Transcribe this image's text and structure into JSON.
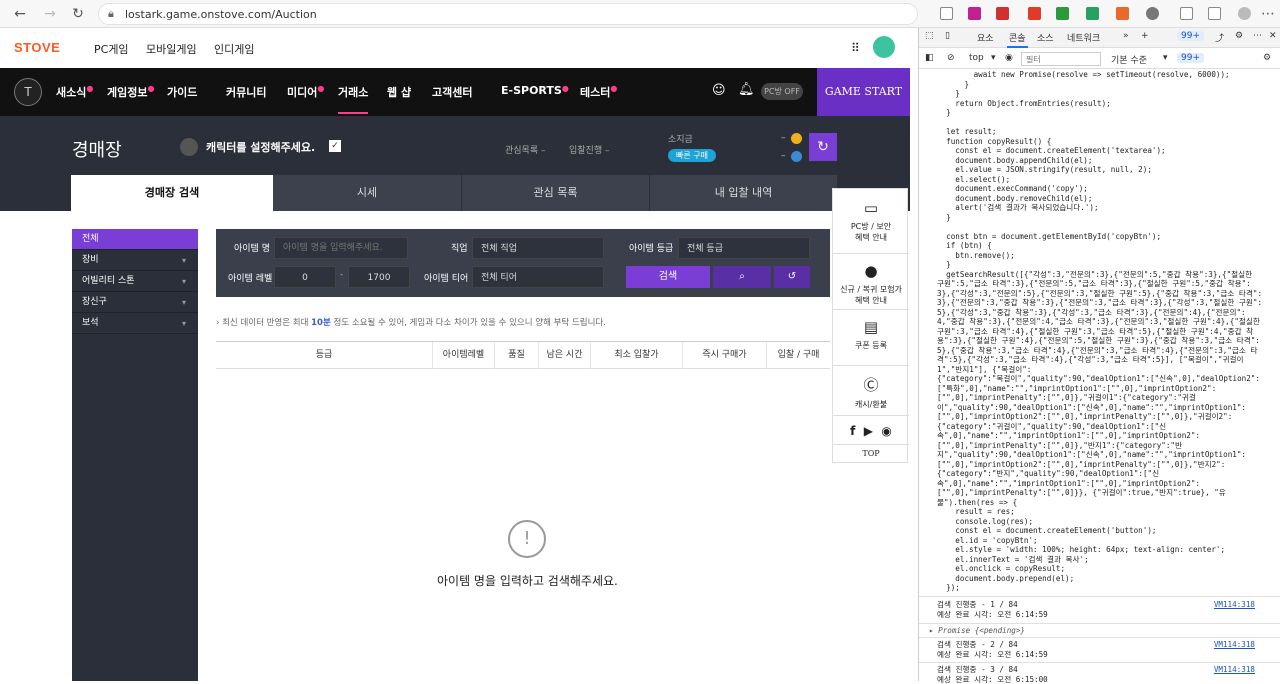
{
  "browser": {
    "url": "lostark.game.onstove.com/Auction",
    "back": "←",
    "refresh": "↻",
    "home": "⌂"
  },
  "site": {
    "logo": "STOVE",
    "topnav": [
      "PC게임",
      "모바일게임",
      "인디게임"
    ],
    "gnb": [
      {
        "label": "새소식",
        "dot": true
      },
      {
        "label": "게임정보",
        "dot": true
      },
      {
        "label": "가이드",
        "dot": false
      },
      {
        "label": "커뮤니티",
        "dot": false
      },
      {
        "label": "미디어",
        "dot": true
      },
      {
        "label": "거래소",
        "dot": false
      },
      {
        "label": "웹 샵",
        "dot": false
      },
      {
        "label": "고객센터",
        "dot": false
      },
      {
        "label": "E-SPORTS",
        "dot": true
      },
      {
        "label": "테스터",
        "dot": true
      }
    ],
    "pc_badge": "PC방 OFF",
    "game_start": "GAME START",
    "page_title": "경매장",
    "character": "캐릭터를 설정해주세요.",
    "watch": "관심목록 –",
    "bidding": "입찰진행 –",
    "owned": "소지금",
    "quick_buy": "빠른 구매",
    "gold1": "–",
    "gold2": "–",
    "tabs": [
      "경매장 검색",
      "시세",
      "관심 목록",
      "내 입찰 내역"
    ],
    "categories": [
      "전체",
      "장비",
      "어빌리티 스톤",
      "장신구",
      "보석"
    ],
    "form": {
      "item_name_label": "아이템 명",
      "item_name_placeholder": "아이템 명을 입력해주세요.",
      "class_label": "직업",
      "class_value": "전체 직업",
      "grade_label": "아이템 등급",
      "grade_value": "전체 등급",
      "level_label": "아이템 레벨",
      "level_min": "0",
      "level_max": "1700",
      "tier_label": "아이템 티어",
      "tier_value": "전체 티어",
      "search": "검색"
    },
    "notice_pre": "최신 데이터 반영은 최대 ",
    "notice_em": "10분",
    "notice_post": " 정도 소요될 수 있어, 게임과 다소 차이가 있을 수 있으니 양해 부탁 드립니다.",
    "columns": [
      "등급",
      "아이템레벨",
      "품질",
      "남은 시간",
      "최소 입찰가",
      "즉시 구매가",
      "입찰 / 구매"
    ],
    "empty": "아이템 명을 입력하고 검색해주세요.",
    "empty_icon": "!",
    "quick": [
      "PC방 / 보안\n혜택 안내",
      "신규 / 복귀 모험가\n혜택 안내",
      "쿠폰 등록",
      "캐시/환불",
      "TOP"
    ]
  },
  "devtools": {
    "tabs": [
      "요소",
      "콘솔",
      "소스",
      "네트워크"
    ],
    "badge": "99+",
    "top": "top",
    "filter_placeholder": "필터",
    "level": "기본 수준",
    "code": "        await new Promise(resolve => setTimeout(resolve, 6000));\n      }\n    }\n    return Object.fromEntries(result);\n  }\n\n  let result;\n  function copyResult() {\n    const el = document.createElement('textarea');\n    document.body.appendChild(el);\n    el.value = JSON.stringify(result, null, 2);\n    el.select();\n    document.execCommand('copy');\n    document.body.removeChild(el);\n    alert('검색 결과가 복사되었습니다.');\n  }\n\n  const btn = document.getElementById('copyBtn');\n  if (btn) {\n    btn.remove();\n  }\n  getSearchResult([{\"각성\":3,\"전문의\":3},{\"전문의\":5,\"중갑 착용\":3},{\"절실한 구원\":5,\"급소 타격\":3},{\"전문의\":5,\"급소 타격\":3},{\"절실한 구원\":5,\"중갑 착용\":3},{\"각성\":3,\"전문의\":5},{\"전문의\":3,\"절실한 구원\":5},{\"중갑 착용\":3,\"급소 타격\":3},{\"전문의\":3,\"중갑 착용\":3},{\"전문의\":3,\"급소 타격\":3},{\"각성\":3,\"절실한 구원\":5},{\"각성\":3,\"중갑 착용\":3},{\"각성\":3,\"급소 타격\":3},{\"전문의\":4},{\"전문의\":4,\"중갑 착용\":3},{\"전문의\":4,\"급소 타격\":3},{\"전문의\":3,\"절실한 구원\":4},{\"절실한 구원\":3,\"급소 타격\":4},{\"절실한 구원\":3,\"급소 타격\":5},{\"절실한 구원\":4,\"중갑 착용\":3},{\"절실한 구원\":4},{\"전문의\":5,\"절실한 구원\":3},{\"중갑 착용\":3,\"급소 타격\":5},{\"중갑 착용\":3,\"급소 타격\":4},{\"전문의\":3,\"급소 타격\":4},{\"전문의\":3,\"급소 타격\":5},{\"각성\":3,\"급소 타격\":4},{\"각성\":3,\"급소 타격\":5}], [\"목걸이\",\"귀걸이1\",\"반지1\"], {\"목걸이\":\n{\"category\":\"목걸이\",\"quality\":90,\"dealOption1\":[\"신속\",0],\"dealOption2\":\n[\"특화\",0],\"name\":\"\",\"imprintOption1\":[\"\",0],\"imprintOption2\":\n[\"\",0],\"imprintPenalty\":[\"\",0]},\"귀걸이1\":{\"category\":\"귀걸\n이\",\"quality\":90,\"dealOption1\":[\"신속\",0],\"name\":\"\",\"imprintOption1\":\n[\"\",0],\"imprintOption2\":[\"\",0],\"imprintPenalty\":[\"\",0]},\"귀걸이2\":\n{\"category\":\"귀걸이\",\"quality\":90,\"dealOption1\":[\"신\n속\",0],\"name\":\"\",\"imprintOption1\":[\"\",0],\"imprintOption2\":\n[\"\",0],\"imprintPenalty\":[\"\",0]},\"반지1\":{\"category\":\"반\n지\",\"quality\":90,\"dealOption1\":[\"신속\",0],\"name\":\"\",\"imprintOption1\":\n[\"\",0],\"imprintOption2\":[\"\",0],\"imprintPenalty\":[\"\",0]},\"반지2\":\n{\"category\":\"반지\",\"quality\":90,\"dealOption1\":[\"신\n속\",0],\"name\":\"\",\"imprintOption1\":[\"\",0],\"imprintOption2\":\n[\"\",0],\"imprintPenalty\":[\"\",0]}}, {\"귀걸이\":true,\"반지\":true}, \"유\n물\").then(res => {\n    result = res;\n    console.log(res);\n    const el = document.createElement('button');\n    el.id = 'copyBtn';\n    el.style = 'width: 100%; height: 64px; text-align: center';\n    el.innerText = '검색 결과 복사';\n    el.onclick = copyResult;\n    document.body.prepend(el);\n  });",
    "logs": [
      {
        "l1": "검색 진행중 - 1 / 84",
        "l2": "예상 완료 시각: 오전 6:14:59",
        "src": "VM114:318"
      },
      {
        "l1": "▸ Promise {<pending>}",
        "l2": "",
        "src": ""
      },
      {
        "l1": "검색 진행중 - 2 / 84",
        "l2": "예상 완료 시각: 오전 6:14:59",
        "src": "VM114:318"
      },
      {
        "l1": "검색 진행중 - 3 / 84",
        "l2": "예상 완료 시각: 오전 6:15:00",
        "src": "VM114:318"
      }
    ]
  }
}
